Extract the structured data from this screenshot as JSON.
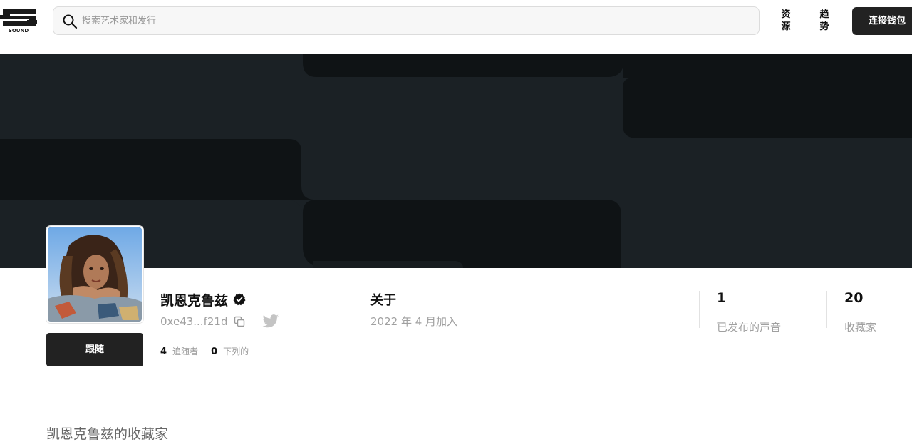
{
  "header": {
    "logo_text": "SOUND",
    "search_placeholder": "搜索艺术家和发行",
    "nav": {
      "resources": "资源",
      "trends": "趋势"
    },
    "connect_wallet": "连接钱包"
  },
  "profile": {
    "name": "凯恩克鲁兹",
    "address": "0xe43...f21d",
    "follow_label": "跟随",
    "followers_count": "4",
    "followers_label": "追随者",
    "following_count": "0",
    "following_label": "下列的"
  },
  "about": {
    "title": "关于",
    "joined": "2022 年 4 月加入"
  },
  "counts": {
    "published_count": "1",
    "published_label": "已发布的声音",
    "collectors_count": "20",
    "collectors_label": "收藏家"
  },
  "section": {
    "title": "凯恩克鲁兹的收藏家"
  },
  "colors": {
    "banner_dark": "#0f1315",
    "banner_light": "#1b2125",
    "button_dark": "#222222"
  },
  "icons": [
    "search-icon",
    "verified-icon",
    "copy-icon",
    "twitter-icon"
  ]
}
